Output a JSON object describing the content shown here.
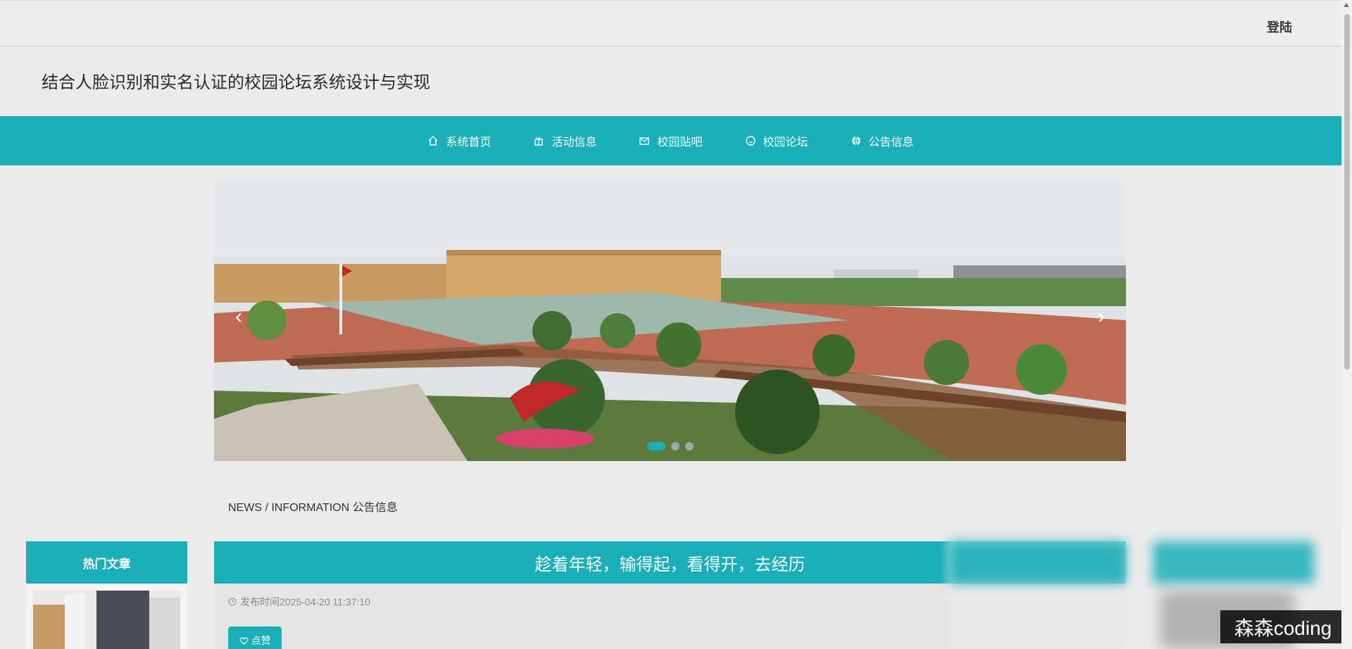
{
  "header": {
    "login": "登陆"
  },
  "site": {
    "title": "结合人脸识别和实名认证的校园论坛系统设计与实现"
  },
  "nav": [
    {
      "label": "系统首页",
      "icon": "home-icon"
    },
    {
      "label": "活动信息",
      "icon": "gift-icon"
    },
    {
      "label": "校园贴吧",
      "icon": "mail-icon"
    },
    {
      "label": "校园论坛",
      "icon": "smile-icon"
    },
    {
      "label": "公告信息",
      "icon": "globe-icon"
    }
  ],
  "carousel": {
    "prev": "‹",
    "next": "›",
    "slides": 3,
    "active_slide": 1
  },
  "section": {
    "label": "NEWS / INFORMATION 公告信息"
  },
  "sidebar": {
    "hot_title": "热门文章"
  },
  "article": {
    "title": "趁着年轻，输得起，看得开，去经历",
    "publish_time": "发布时间2025-04-20 11:37:10",
    "like_label": "点赞"
  },
  "watermark": "森森coding",
  "colors": {
    "accent": "#19aeb8",
    "background": "#ebebeb"
  }
}
